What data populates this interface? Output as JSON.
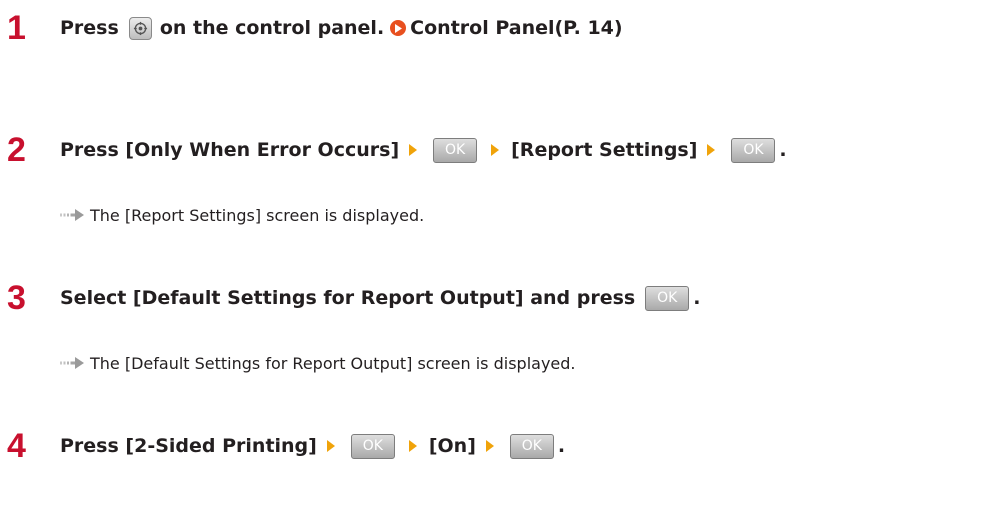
{
  "steps": [
    {
      "number": "1",
      "text_before": "Press",
      "icon": "settings-menu-key-icon",
      "text_after": "on the control panel.",
      "link_text": "Control Panel(P. 14)"
    },
    {
      "number": "2",
      "parts": [
        "Press [Only When Error Occurs]",
        "[Report Settings]",
        "."
      ],
      "ok_label": "OK",
      "result": "The [Report Settings] screen is displayed."
    },
    {
      "number": "3",
      "text": "Select [Default Settings for Report Output] and press",
      "ok_label": "OK",
      "end": ".",
      "result": "The [Default Settings for Report Output] screen is displayed."
    },
    {
      "number": "4",
      "parts": [
        "Press [2-Sided Printing]",
        "[On]",
        "."
      ],
      "ok_label": "OK"
    }
  ],
  "colors": {
    "step_number": "#c8102e",
    "arrow": "#f0a30a",
    "link_icon": "#e8501f",
    "result_arrow": "#a6a6a6"
  }
}
